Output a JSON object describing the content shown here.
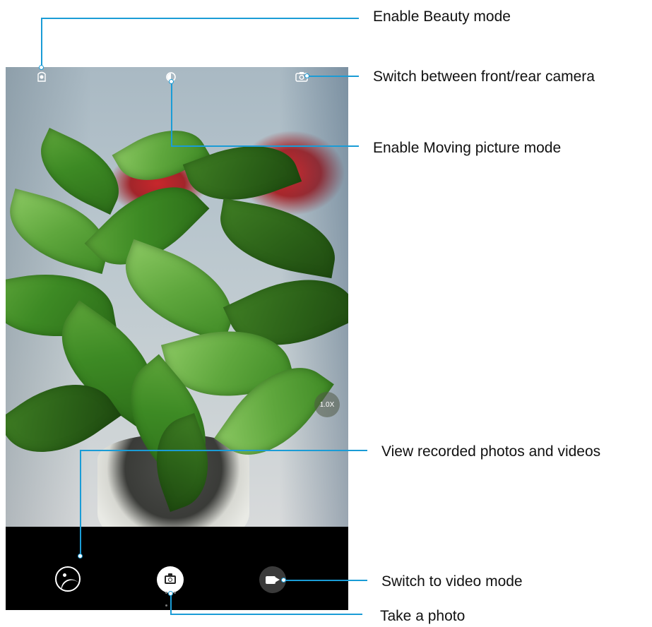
{
  "viewfinder": {
    "zoom_level": "1.0X",
    "beauty_icon": "beauty-mode-icon",
    "moving_picture_icon": "moving-picture-icon",
    "switch_camera_icon": "switch-camera-icon"
  },
  "controls": {
    "gallery_icon": "gallery-icon",
    "shutter_icon": "camera-icon",
    "video_icon": "video-camera-icon"
  },
  "callouts": {
    "beauty": "Enable Beauty mode",
    "switch_camera": "Switch between front/rear camera",
    "moving_picture": "Enable Moving picture mode",
    "gallery": "View recorded photos and videos",
    "video_mode": "Switch to video mode",
    "take_photo": "Take a photo"
  },
  "colors": {
    "callout_line": "#1a9cd6",
    "control_bar": "#000000"
  }
}
